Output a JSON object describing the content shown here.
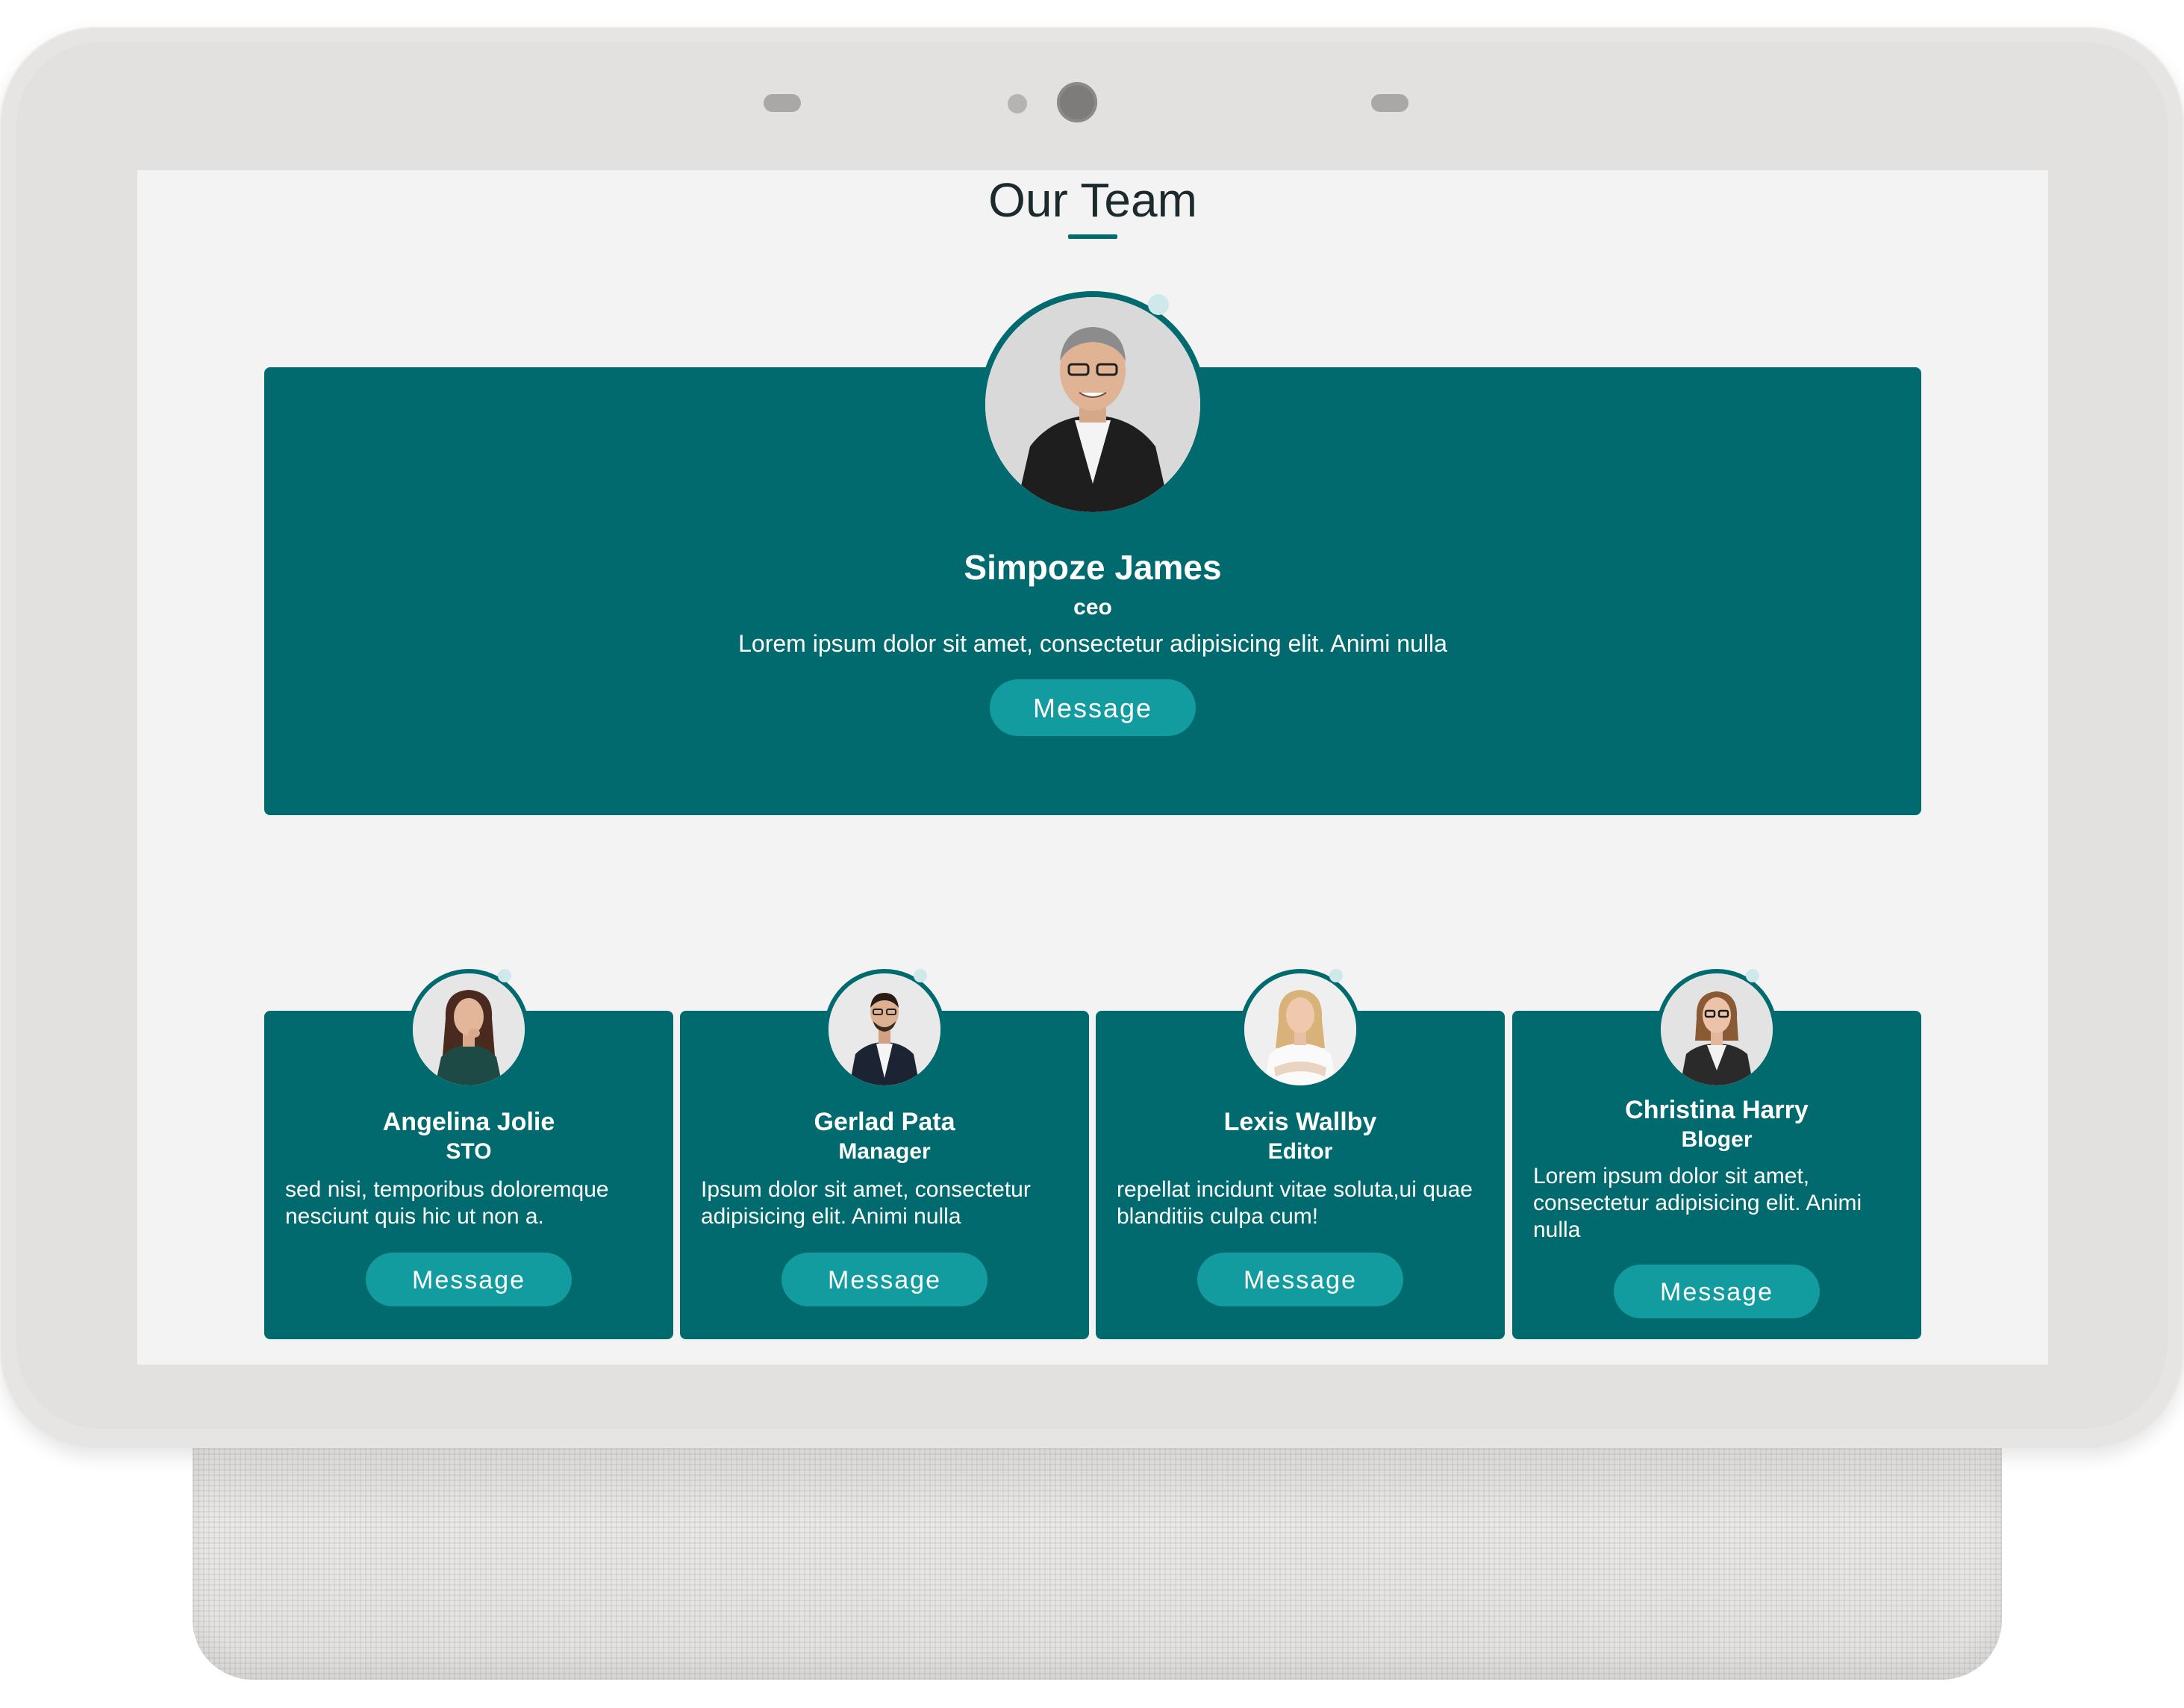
{
  "page": {
    "title": "Our Team"
  },
  "ceo": {
    "name": "Simpoze James",
    "role": "ceo",
    "description": "Lorem ipsum dolor sit amet, consectetur adipisicing elit. Animi nulla",
    "button_label": "Message"
  },
  "members": [
    {
      "name": "Angelina Jolie",
      "role": "STO",
      "description": "sed nisi, temporibus doloremque nesciunt quis hic ut non a.",
      "button_label": "Message"
    },
    {
      "name": "Gerlad Pata",
      "role": "Manager",
      "description": "Ipsum dolor sit amet, consectetur adipisicing elit. Animi nulla",
      "button_label": "Message"
    },
    {
      "name": "Lexis Wallby",
      "role": "Editor",
      "description": "repellat incidunt vitae soluta,ui quae blanditiis culpa cum!",
      "button_label": "Message"
    },
    {
      "name": "Christina Harry",
      "role": "Bloger",
      "description": "Lorem ipsum dolor sit amet, consectetur adipisicing elit. Animi nulla",
      "button_label": "Message"
    }
  ],
  "colors": {
    "card_background": "#006a6e",
    "button_background": "#139ca0",
    "screen_background": "#f3f3f3",
    "title_text": "#1d2a2c"
  },
  "icons": {
    "avatars": [
      "person-photo",
      "person-photo",
      "person-photo",
      "person-photo",
      "person-photo"
    ]
  }
}
